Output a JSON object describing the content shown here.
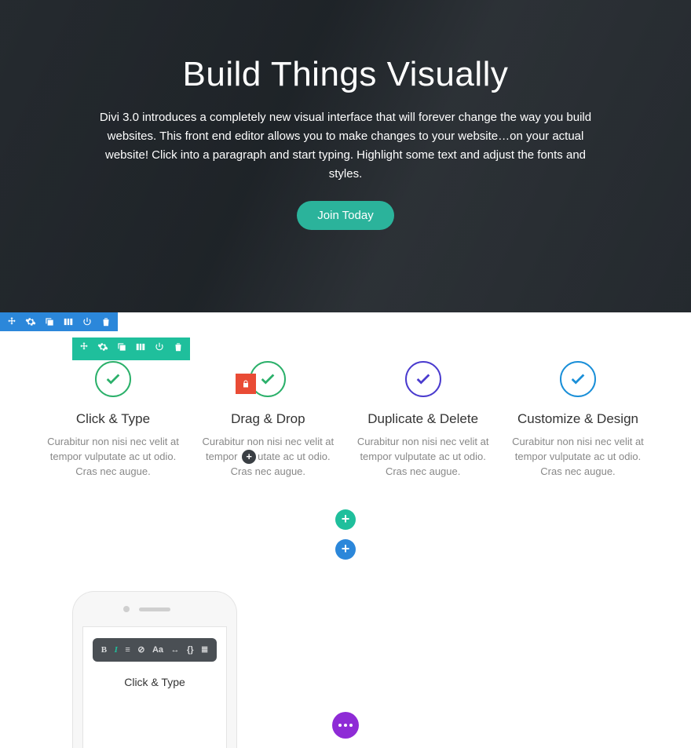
{
  "hero": {
    "title": "Build Things Visually",
    "body": "Divi 3.0 introduces a completely new visual interface that will forever change the way you build websites. This front end editor allows you to make changes to your website…on your actual website! Click into a paragraph and start typing. Highlight some text and adjust the fonts and styles.",
    "cta_label": "Join Today"
  },
  "section_toolbar": [
    "move",
    "settings",
    "duplicate",
    "columns",
    "power",
    "delete"
  ],
  "module_toolbar": [
    "move",
    "settings",
    "duplicate",
    "columns",
    "power",
    "delete"
  ],
  "features": [
    {
      "title": "Click & Type",
      "body_pre": "Curabitur non nisi nec velit at tempor vulputate ac ut odio. Cras nec augue.",
      "body_post": "",
      "color": "#2bb06a"
    },
    {
      "title": "Drag & Drop",
      "body_pre": "Curabitur non nisi nec velit at tempor ",
      "body_post": "utate ac ut odio. Cras nec augue.",
      "color": "#2bb06a"
    },
    {
      "title": "Duplicate & Delete",
      "body_pre": "Curabitur non nisi nec velit at tempor vulputate ac ut odio. Cras nec augue.",
      "body_post": "",
      "color": "#4a3bce"
    },
    {
      "title": "Customize & Design",
      "body_pre": "Curabitur non nisi nec velit at tempor vulputate ac ut odio. Cras nec augue.",
      "body_post": "",
      "color": "#1a8fd8"
    }
  ],
  "rte_buttons": [
    "B",
    "I",
    "≡",
    "⊘",
    "Aa",
    "↔",
    "{}",
    "≣"
  ],
  "phone_title": "Click & Type",
  "colors": {
    "section_toolbar": "#2b87da",
    "module_toolbar": "#1fbf9c",
    "lock_badge": "#e94b35",
    "fab": "#8e2bd6"
  }
}
